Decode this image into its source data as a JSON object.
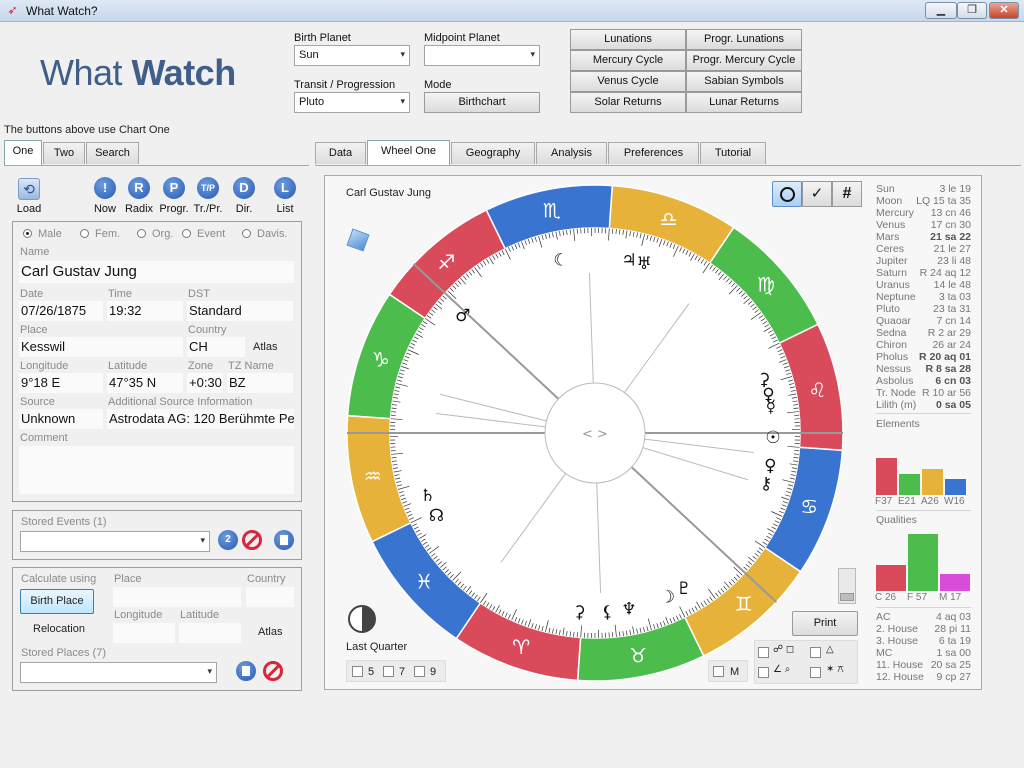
{
  "window": {
    "title": "What Watch?",
    "min": "▁",
    "max": "❐",
    "close": "✕"
  },
  "logo": {
    "light": "What ",
    "bold": "Watch"
  },
  "controls": {
    "birth_planet_label": "Birth Planet",
    "birth_planet": "Sun",
    "midpoint_planet_label": "Midpoint Planet",
    "midpoint_planet": "",
    "transit_label": "Transit / Progression",
    "transit": "Pluto",
    "mode_label": "Mode",
    "mode": "Birthchart"
  },
  "grid_buttons": [
    "Lunations",
    "Progr. Lunations",
    "Mercury Cycle",
    "Progr. Mercury Cycle",
    "Venus Cycle",
    "Sabian Symbols",
    "Solar Returns",
    "Lunar Returns"
  ],
  "hint": "The buttons above use Chart One",
  "left_tabs": [
    "One",
    "Two",
    "Search"
  ],
  "main_tabs": [
    "Data",
    "Wheel One",
    "Geography",
    "Analysis",
    "Preferences",
    "Tutorial"
  ],
  "toolbar": {
    "load": "Load",
    "buttons": [
      {
        "glyph": "!",
        "label": "Now"
      },
      {
        "glyph": "R",
        "label": "Radix"
      },
      {
        "glyph": "P",
        "label": "Progr."
      },
      {
        "glyph": "T/P",
        "label": "Tr./Pr."
      },
      {
        "glyph": "D",
        "label": "Dir."
      },
      {
        "glyph": "L",
        "label": "List"
      }
    ]
  },
  "chart_type": [
    "Male",
    "Fem.",
    "Org.",
    "Event",
    "Davis."
  ],
  "person": {
    "name_label": "Name",
    "name": "Carl Gustav Jung",
    "date_label": "Date",
    "date": "07/26/1875",
    "time_label": "Time",
    "time": "19:32",
    "dst_label": "DST",
    "dst": "Standard",
    "place_label": "Place",
    "place": "Kesswil",
    "country_label": "Country",
    "country": "CH",
    "atlas": "Atlas",
    "lon_label": "Longitude",
    "lon": "9°18 E",
    "lat_label": "Latitude",
    "lat": "47°35 N",
    "zone_label": "Zone",
    "zone": "+0:30",
    "tz_label": "TZ Name",
    "tz": "BZ",
    "source_label": "Source",
    "source": "Unknown",
    "addsource_label": "Additional Source Information",
    "addsource": "Astrodata AG: 120 Berühmte Pe",
    "comment_label": "Comment"
  },
  "stored_events": {
    "label": "Stored Events (1)",
    "badge": "2"
  },
  "calc": {
    "label": "Calculate using",
    "place_label": "Place",
    "country_label": "Country",
    "birth_place": "Birth Place",
    "relocation": "Relocation",
    "lon_label": "Longitude",
    "lat_label": "Latitude",
    "atlas": "Atlas",
    "stored_places": "Stored Places (7)"
  },
  "wheel": {
    "chart_name": "Carl Gustav Jung",
    "center": "< >",
    "moon_phase": "Last Quarter",
    "print": "Print",
    "harmonics": [
      "5",
      "7",
      "9"
    ],
    "m_label": "M",
    "signs": [
      {
        "name": "Aries",
        "glyph": "♈",
        "color": "#d94b5a"
      },
      {
        "name": "Taurus",
        "glyph": "♉",
        "color": "#4cbd4c"
      },
      {
        "name": "Gemini",
        "glyph": "♊",
        "color": "#e6b23a"
      },
      {
        "name": "Cancer",
        "glyph": "♋",
        "color": "#3a74d1"
      },
      {
        "name": "Leo",
        "glyph": "♌",
        "color": "#d94b5a"
      },
      {
        "name": "Virgo",
        "glyph": "♍",
        "color": "#4cbd4c"
      },
      {
        "name": "Libra",
        "glyph": "♎",
        "color": "#e6b23a"
      },
      {
        "name": "Scorpio",
        "glyph": "♏",
        "color": "#3a74d1"
      },
      {
        "name": "Sagittarius",
        "glyph": "♐",
        "color": "#d94b5a"
      },
      {
        "name": "Capricorn",
        "glyph": "♑",
        "color": "#4cbd4c"
      },
      {
        "name": "Aquarius",
        "glyph": "♒",
        "color": "#e6b23a"
      },
      {
        "name": "Pisces",
        "glyph": "♓",
        "color": "#3a74d1"
      }
    ],
    "planet_glyphs": [
      {
        "name": "moon",
        "glyph": "☾",
        "lon": 225
      },
      {
        "name": "mars",
        "glyph": "♂",
        "lon": 262
      },
      {
        "name": "jupiter",
        "glyph": "♃",
        "lon": 203
      },
      {
        "name": "uranus",
        "glyph": "♅",
        "lon": 198
      },
      {
        "name": "venus-2",
        "glyph": "♀",
        "lon": 114
      },
      {
        "name": "chiron",
        "glyph": "⚷",
        "lon": 108
      },
      {
        "name": "sun",
        "glyph": "☉",
        "lon": 123
      },
      {
        "name": "venus",
        "glyph": "♀",
        "lon": 137
      },
      {
        "name": "mercury",
        "glyph": "☿",
        "lon": 133
      },
      {
        "name": "node",
        "glyph": "☊",
        "lon": 331
      },
      {
        "name": "saturn",
        "glyph": "♄",
        "lon": 324
      },
      {
        "name": "lilith",
        "glyph": "⚸",
        "lon": 38
      },
      {
        "name": "neptune",
        "glyph": "♆",
        "lon": 45
      },
      {
        "name": "moon-2",
        "glyph": "☽",
        "lon": 58
      },
      {
        "name": "pluto",
        "glyph": "♇",
        "lon": 64
      },
      {
        "name": "eris",
        "glyph": "⚳",
        "lon": 29
      },
      {
        "name": "ceres",
        "glyph": "⚳",
        "lon": 142
      }
    ]
  },
  "positions": [
    {
      "p": "Sun",
      "v": "3 le 19",
      "b": false
    },
    {
      "p": "Moon",
      "v": "LQ 15 ta 35",
      "b": false
    },
    {
      "p": "Mercury",
      "v": "13 cn 46",
      "b": false
    },
    {
      "p": "Venus",
      "v": "17 cn 30",
      "b": false
    },
    {
      "p": "Mars",
      "v": "21 sa 22",
      "b": true
    },
    {
      "p": "Ceres",
      "v": "21 le 27",
      "b": false
    },
    {
      "p": "Jupiter",
      "v": "23 li 48",
      "b": false
    },
    {
      "p": "Saturn",
      "v": "R 24 aq 12",
      "b": false
    },
    {
      "p": "Uranus",
      "v": "14 le 48",
      "b": false
    },
    {
      "p": "Neptune",
      "v": "3 ta 03",
      "b": false
    },
    {
      "p": "Pluto",
      "v": "23 ta 31",
      "b": false
    },
    {
      "p": "Quaoar",
      "v": "7 cn 14",
      "b": false
    },
    {
      "p": "Sedna",
      "v": "R 2 ar 29",
      "b": false
    },
    {
      "p": "Chiron",
      "v": "26 ar 24",
      "b": false
    },
    {
      "p": "Pholus",
      "v": "R 20 aq 01",
      "b": true
    },
    {
      "p": "Nessus",
      "v": "R 8 sa 28",
      "b": true
    },
    {
      "p": "Asbolus",
      "v": "6 cn 03",
      "b": true
    },
    {
      "p": "Tr. Node",
      "v": "R 10 ar 56",
      "b": false
    },
    {
      "p": "Lilith (m)",
      "v": "0 sa 05",
      "b": true
    }
  ],
  "elements": {
    "label": "Elements",
    "bars": [
      {
        "label": "F37",
        "value": 37,
        "color": "#d94b5a"
      },
      {
        "label": "E21",
        "value": 21,
        "color": "#4cbd4c"
      },
      {
        "label": "A26",
        "value": 26,
        "color": "#e6b23a"
      },
      {
        "label": "W16",
        "value": 16,
        "color": "#3a74d1"
      }
    ]
  },
  "qualities": {
    "label": "Qualities",
    "bars": [
      {
        "label": "C 26",
        "value": 26,
        "color": "#d94b5a"
      },
      {
        "label": "F 57",
        "value": 57,
        "color": "#4cbd4c"
      },
      {
        "label": "M 17",
        "value": 17,
        "color": "#d94bd9"
      }
    ]
  },
  "houses": [
    {
      "p": "AC",
      "v": "4 aq 03"
    },
    {
      "p": "2. House",
      "v": "28 pi 11"
    },
    {
      "p": "3. House",
      "v": "6 ta 19"
    },
    {
      "p": "MC",
      "v": "1 sa 00"
    },
    {
      "p": "11. House",
      "v": "20 sa 25"
    },
    {
      "p": "12. House",
      "v": "9 cp 27"
    }
  ]
}
